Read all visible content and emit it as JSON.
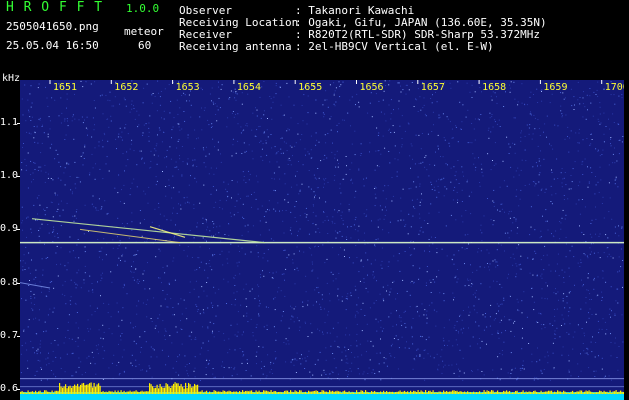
{
  "app": {
    "title": "H R O F F T",
    "version": "1.0.0"
  },
  "file": {
    "name": "2505041650.png",
    "datetime": "25.05.04 16:50"
  },
  "mode": {
    "label": "meteor",
    "value": "60"
  },
  "info": {
    "labels": [
      "Observer",
      "Receiving Location",
      "Receiver",
      "Receiving antenna"
    ],
    "values": [
      ": Takanori Kawachi",
      ": Ogaki, Gifu, JAPAN (136.60E, 35.35N)",
      ": R820T2(RTL-SDR) SDR-Sharp 53.372MHz",
      ": 2el-HB9CV Vertical (el. E-W)"
    ]
  },
  "chart_data": {
    "type": "heatmap",
    "ylabel": "kHz",
    "x_ticks": [
      "1651",
      "1652",
      "1653",
      "1654",
      "1655",
      "1656",
      "1657",
      "1658",
      "1659",
      "1700"
    ],
    "y_ticks": [
      "1.1",
      "1.0",
      "0.9",
      "0.8",
      "0.7",
      "0.6"
    ],
    "y_range": [
      0.58,
      1.18
    ],
    "carrier_khz": 0.875
  },
  "colors": {
    "background": "#141a7a",
    "label_green": "#33ff33",
    "value_yellow": "#ffff33",
    "carrier": "#e0ffcc",
    "level_cyan": "#00d8ff",
    "level_yellow": "#ffee00"
  }
}
